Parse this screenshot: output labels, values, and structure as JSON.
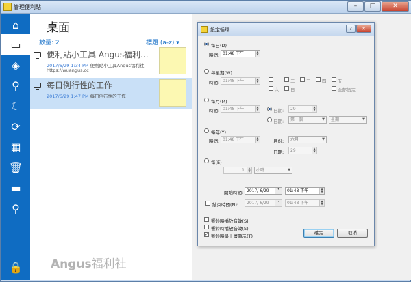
{
  "app": {
    "title": "管理便利貼"
  },
  "sidebar": {
    "items": [
      {
        "name": "home",
        "icon": "⌂"
      },
      {
        "name": "desktop",
        "icon": "▭"
      },
      {
        "name": "layers",
        "icon": "◈"
      },
      {
        "name": "attachment",
        "icon": "⚲"
      },
      {
        "name": "night",
        "icon": "☾"
      },
      {
        "name": "repeat",
        "icon": "⟳"
      },
      {
        "name": "calendar",
        "icon": "▦"
      },
      {
        "name": "trash",
        "icon": "🗑"
      },
      {
        "name": "folder",
        "icon": "▬"
      },
      {
        "name": "search",
        "icon": "⚲"
      },
      {
        "name": "lock",
        "icon": "🔒"
      }
    ]
  },
  "main": {
    "title": "桌面",
    "count_label": "數量: 2",
    "sort_label": "標題 (a-z) ▾",
    "notes": [
      {
        "title": "便利貼小工具  Angus福利...",
        "date": "2017/6/29 1:34 PM",
        "preview": "便利貼小工具Angus福利社",
        "url": "https://wuangus.cc"
      },
      {
        "title": "每日例行性的工作",
        "date": "2017/6/29 1:47 PM",
        "preview": "每日例行性的工作",
        "url": ""
      }
    ],
    "brand_latin": "Angus",
    "brand_cjk": "福利社"
  },
  "dialog": {
    "title": "設定循環",
    "daily": {
      "label": "每日(D)",
      "time_label": "時間:",
      "time_value": "01:48 下午"
    },
    "weekly": {
      "label": "每星期(W)",
      "time_label": "時間:",
      "time_value": "01:48 下午",
      "days": [
        "一",
        "二",
        "三",
        "四",
        "五",
        "六",
        "日"
      ],
      "all_days": "全部設定"
    },
    "monthly": {
      "label": "每月(M)",
      "time_label": "時間:",
      "time_value": "01:48 下午",
      "date_label": "日期:",
      "date_value": "29",
      "day_label": "日期:",
      "week_value": "第一個",
      "weekday_value": "星期一"
    },
    "yearly": {
      "label": "每年(Y)",
      "time_label": "時間:",
      "time_value": "01:48 下午",
      "month_label": "月份:",
      "month_value": "六月",
      "date_label": "日期:",
      "date_value": "29"
    },
    "every": {
      "label": "每(E)",
      "value": "1",
      "unit": "小時"
    },
    "start": {
      "label": "開始時間:",
      "date": "2017/ 6/29",
      "time": "01:48 下午"
    },
    "end": {
      "label": "結束時間(N):",
      "date": "2017/ 6/29",
      "time": "01:48 下午"
    },
    "options": [
      {
        "label": "響鈴時播放音效(S)",
        "checked": false
      },
      {
        "label": "響鈴時播放音效(S)",
        "checked": false
      },
      {
        "label": "響鈴時最上層顯示(T)",
        "checked": true
      }
    ],
    "ok": "確定",
    "cancel": "取消"
  }
}
